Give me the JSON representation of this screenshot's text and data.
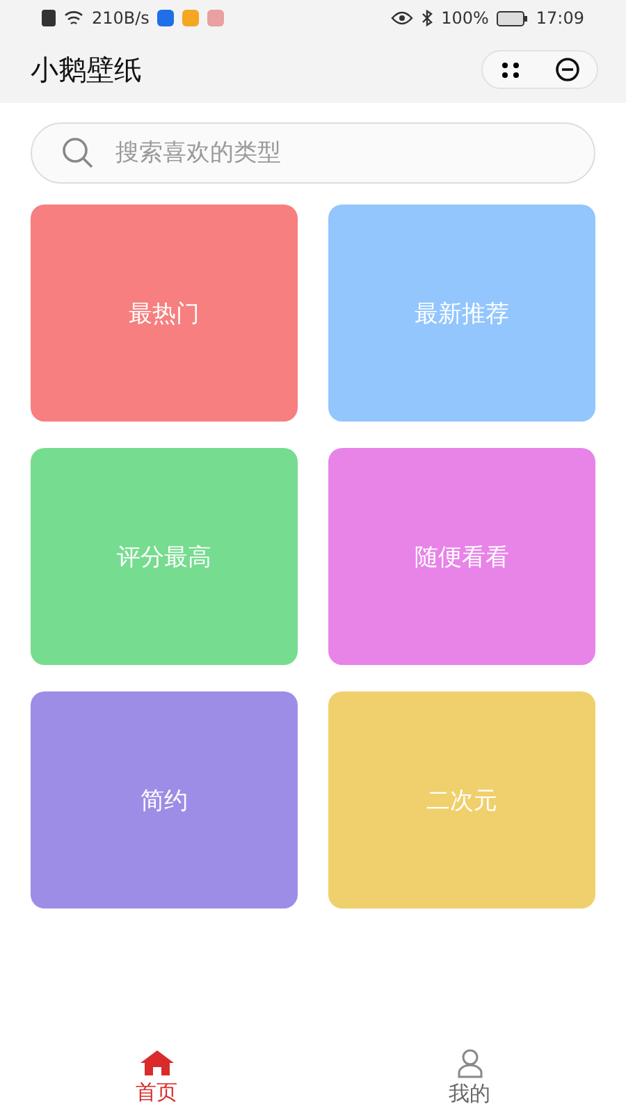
{
  "status_bar": {
    "speed": "210B/s",
    "battery": "100%",
    "time": "17:09"
  },
  "header": {
    "title": "小鹅壁纸"
  },
  "search": {
    "placeholder": "搜索喜欢的类型"
  },
  "categories": [
    {
      "label": "最热门",
      "color": "#f77f7f"
    },
    {
      "label": "最新推荐",
      "color": "#92c6fd"
    },
    {
      "label": "评分最高",
      "color": "#76dc8f"
    },
    {
      "label": "随便看看",
      "color": "#e883e8"
    },
    {
      "label": "简约",
      "color": "#9e8de6"
    },
    {
      "label": "二次元",
      "color": "#f0d06c"
    }
  ],
  "tabs": [
    {
      "label": "首页",
      "kind": "home",
      "selected": true
    },
    {
      "label": "我的",
      "kind": "profile",
      "selected": false
    }
  ]
}
